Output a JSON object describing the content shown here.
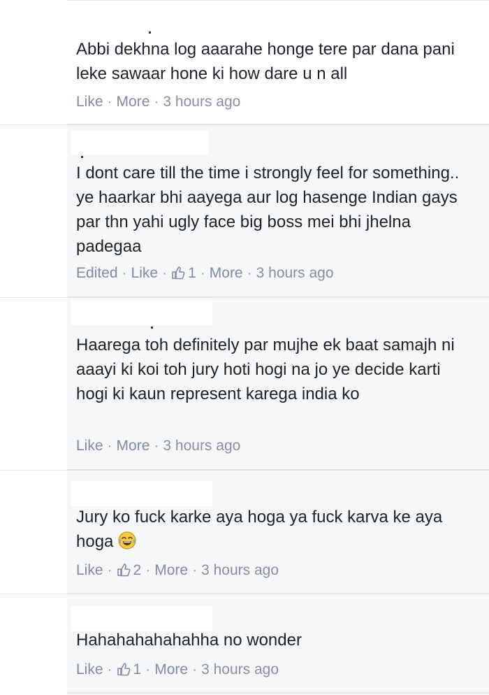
{
  "comments": [
    {
      "text": "Abbi dekhna log aaarahe honge tere par dana pani leke sawaar hone ki how dare u n all",
      "edited": "",
      "like": "Like",
      "reactions": "",
      "more": "More",
      "time": "3 hours ago"
    },
    {
      "text": "I dont care till the time i strongly feel for something.. ye haarkar bhi aayega aur log hasenge Indian gays par thn yahi ugly face big boss mei bhi jhelna padegaa",
      "edited": "Edited",
      "like": "Like",
      "reactions": "1",
      "more": "More",
      "time": "3 hours ago"
    },
    {
      "text": "Haarega toh definitely par mujhe ek baat samajh ni aaayi ki koi toh jury hoti hogi na jo ye decide karti hogi ki kaun represent karega india ko",
      "edited": "",
      "like": "Like",
      "reactions": "",
      "more": "More",
      "time": "3 hours ago"
    },
    {
      "text": "Jury ko fuck karke aya hoga ya fuck karva ke aya hoga",
      "edited": "",
      "like": "Like",
      "reactions": "2",
      "more": "More",
      "time": "3 hours ago",
      "emoji": "tears-of-joy-emoji-icon"
    },
    {
      "text": "Hahahahahahahha no wonder",
      "edited": "",
      "like": "Like",
      "reactions": "1",
      "more": "More",
      "time": "3 hours ago"
    }
  ],
  "colors": {
    "link": "#7f8ba6",
    "text": "#1d2129",
    "background": "#f6f7f9"
  }
}
